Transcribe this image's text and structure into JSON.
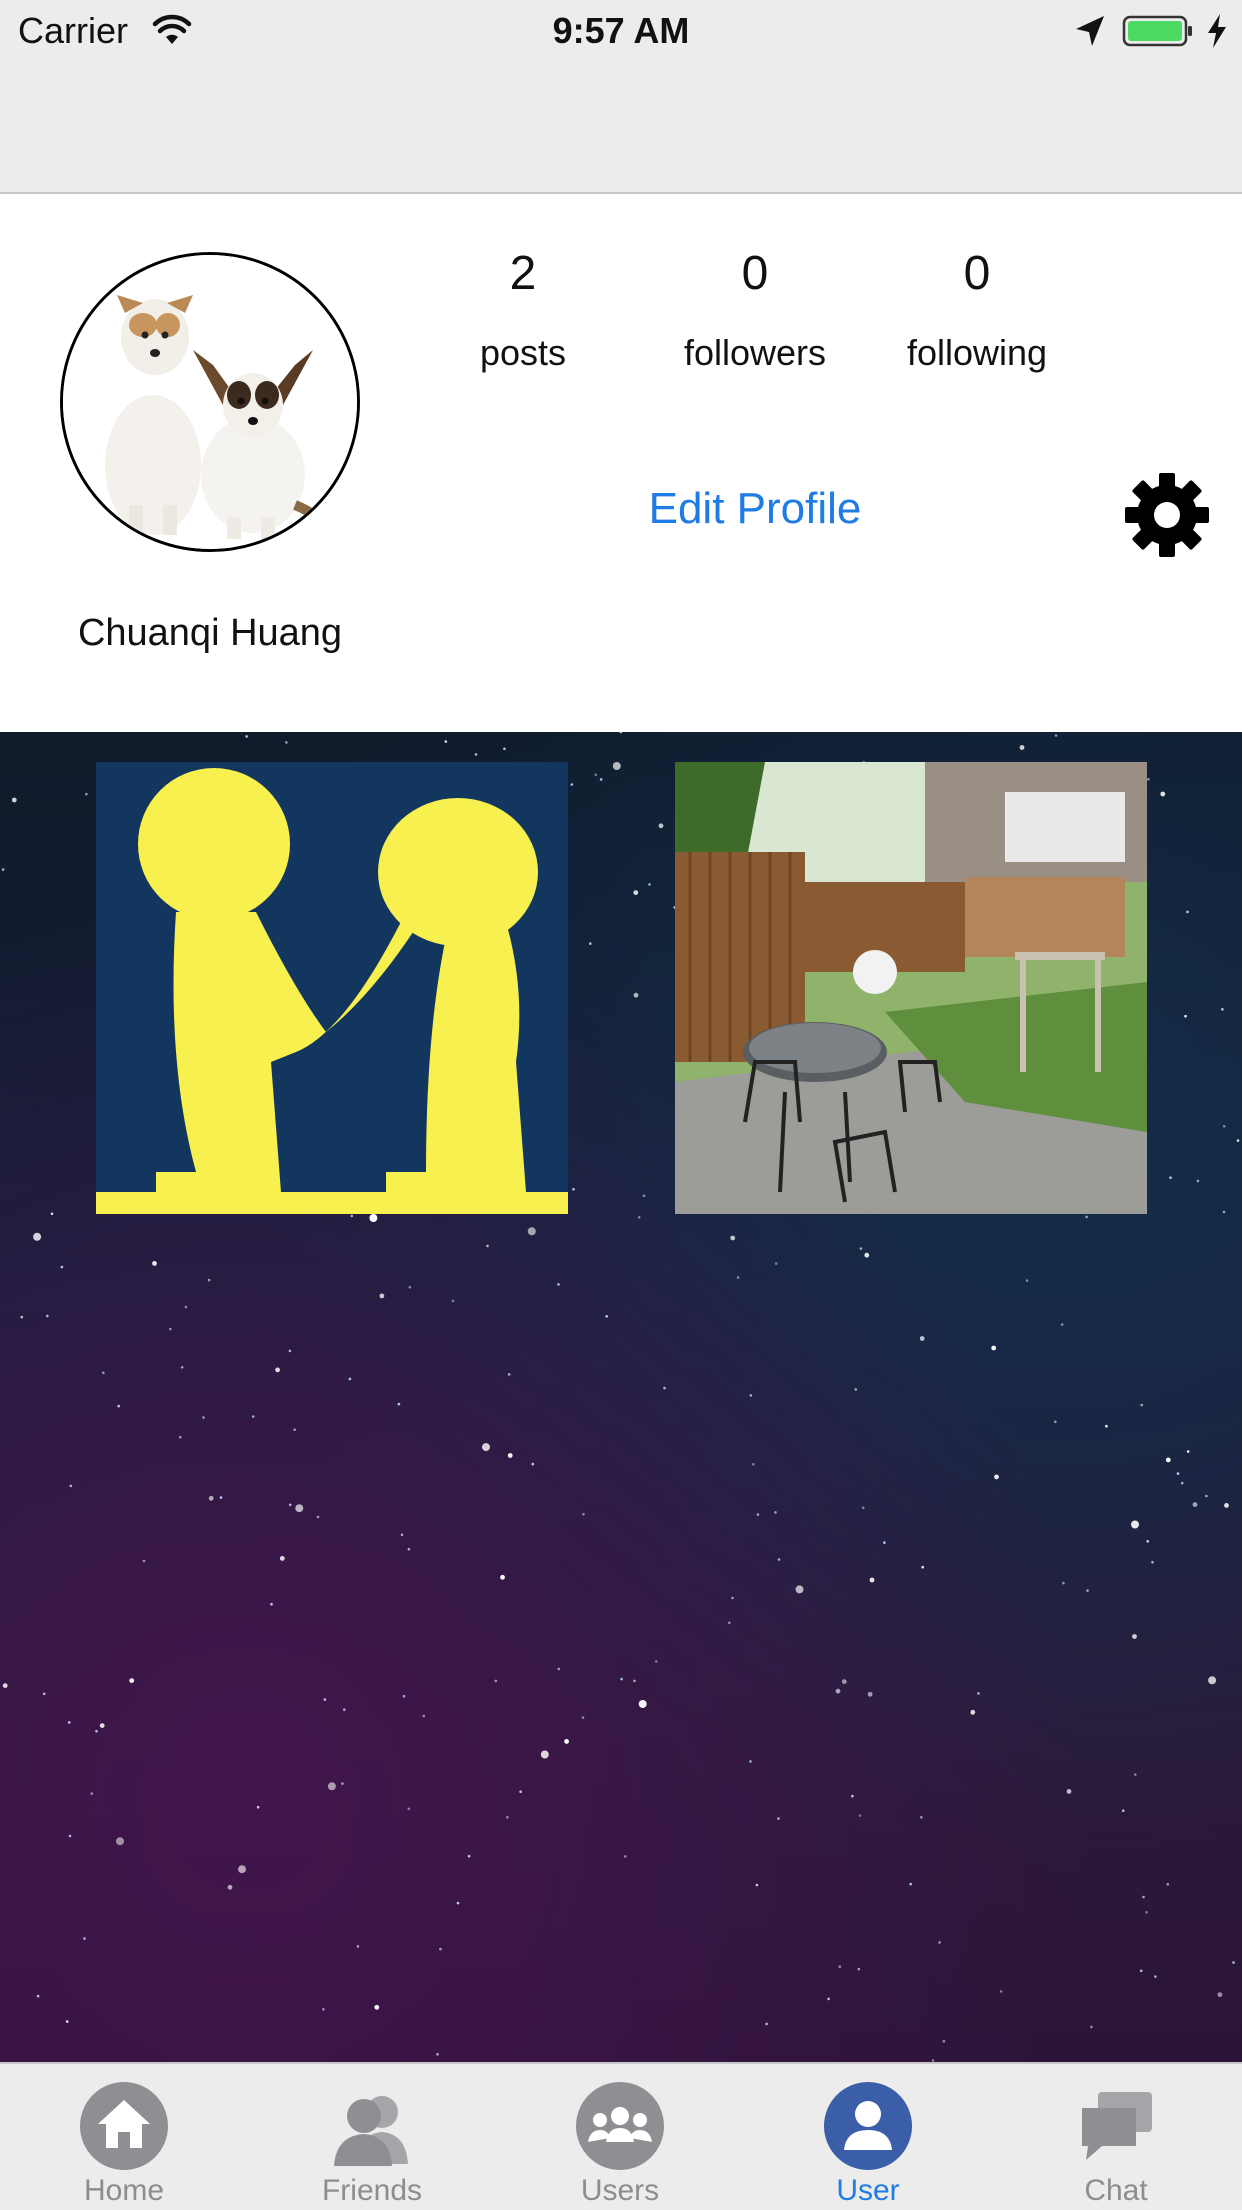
{
  "status_bar": {
    "carrier": "Carrier",
    "time": "9:57 AM"
  },
  "profile": {
    "name": "Chuanqi Huang",
    "stats": [
      {
        "value": "2",
        "label": "posts"
      },
      {
        "value": "0",
        "label": "followers"
      },
      {
        "value": "0",
        "label": "following"
      }
    ],
    "edit_label": "Edit Profile"
  },
  "posts": [
    {
      "kind": "illustration",
      "subject": "two yellow figures holding hands"
    },
    {
      "kind": "photo",
      "subject": "backyard patio with table and chairs"
    }
  ],
  "tabs": [
    {
      "label": "Home",
      "icon": "home-icon",
      "active": false
    },
    {
      "label": "Friends",
      "icon": "friends-icon",
      "active": false
    },
    {
      "label": "Users",
      "icon": "users-icon",
      "active": false
    },
    {
      "label": "User",
      "icon": "user-icon",
      "active": true
    },
    {
      "label": "Chat",
      "icon": "chat-icon",
      "active": false
    }
  ],
  "colors": {
    "accent": "#1f7be6",
    "tab_inactive": "#8d8d8d",
    "tab_active_bg": "#3a5fa8"
  }
}
